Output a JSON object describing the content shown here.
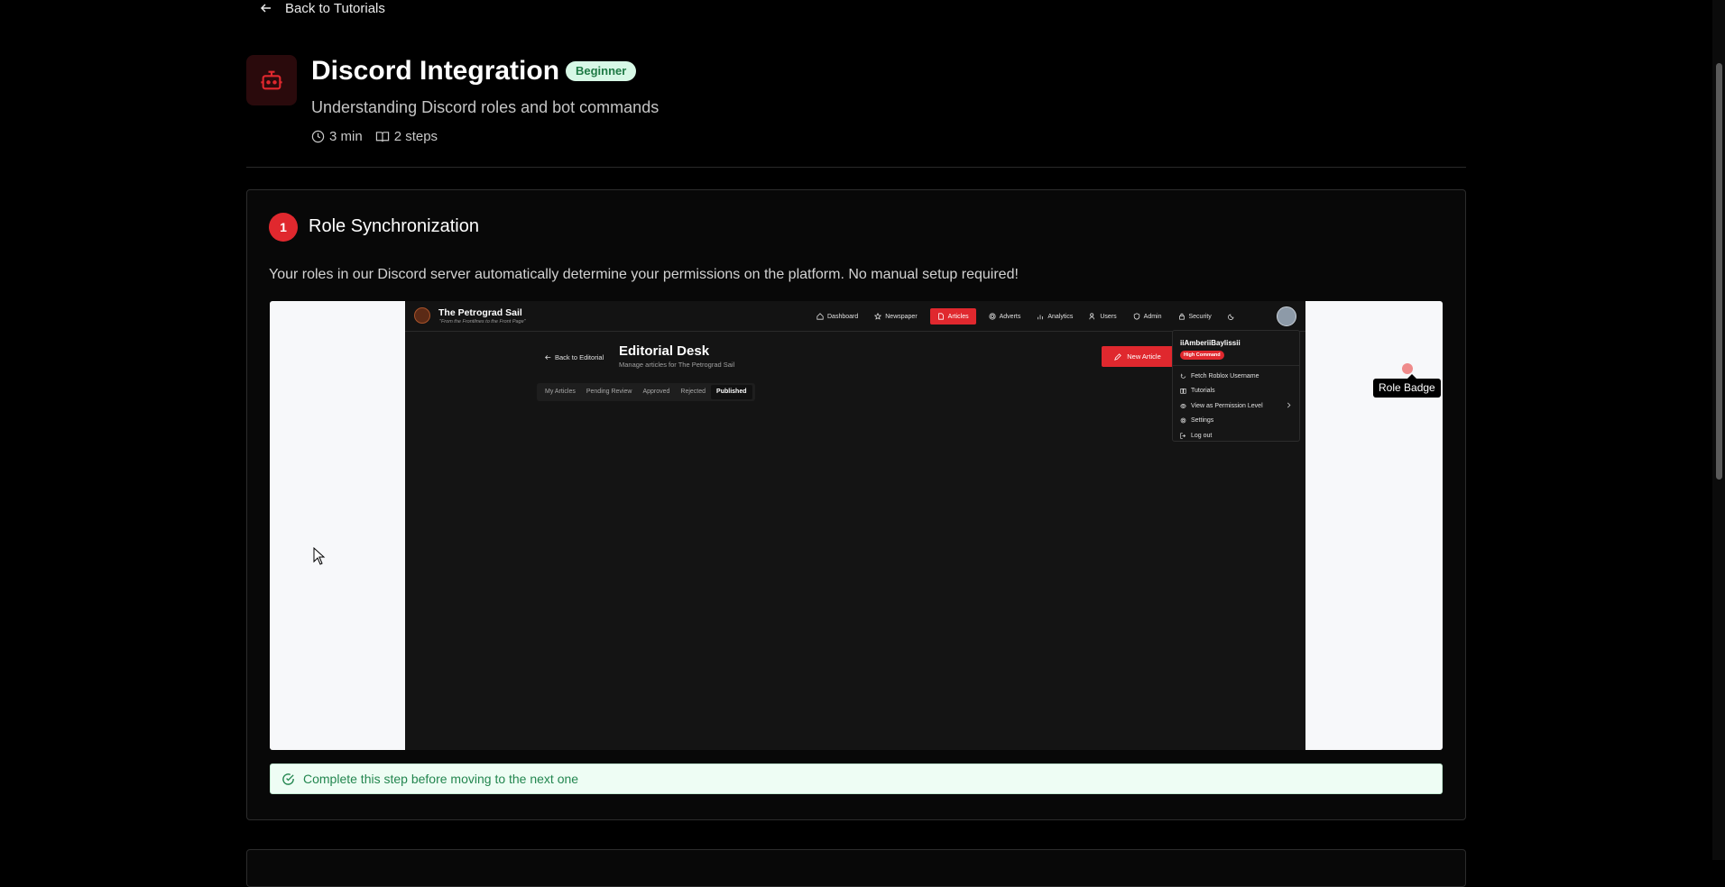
{
  "back_link": {
    "label": "Back to Tutorials"
  },
  "tutorial": {
    "title": "Discord Integration",
    "level_badge": "Beginner",
    "subtitle": "Understanding Discord roles and bot commands",
    "duration": "3 min",
    "steps_count": "2 steps",
    "icon": "bot-icon"
  },
  "step": {
    "number": "1",
    "title": "Role Synchronization",
    "description": "Your roles in our Discord server automatically determine your permissions on the platform. No manual setup required!",
    "tooltip": "Role Badge",
    "notice": "Complete this step before moving to the next one"
  },
  "screenshot": {
    "brand": "The Petrograd Sail",
    "tagline": "\"From the Frontlines to the Front Page\"",
    "nav": [
      "Dashboard",
      "Newspaper",
      "Articles",
      "Adverts",
      "Analytics",
      "Users",
      "Admin",
      "Security"
    ],
    "nav_active": "Articles",
    "back": "Back to Editorial",
    "page_title": "Editorial Desk",
    "page_subtitle": "Manage articles for The Petrograd Sail",
    "tabs": [
      "My Articles",
      "Pending Review",
      "Approved",
      "Rejected",
      "Published"
    ],
    "tab_active": "Published",
    "new_article": "New Article",
    "menu": {
      "username": "iiAmberiiBaylissii",
      "role": "High Command",
      "items": [
        "Fetch Roblox Username",
        "Tutorials",
        "View as Permission Level",
        "Settings",
        "Log out"
      ]
    }
  },
  "colors": {
    "accent": "#e0282e",
    "success": "#23864f",
    "badge_bg": "#d7f8e6"
  }
}
